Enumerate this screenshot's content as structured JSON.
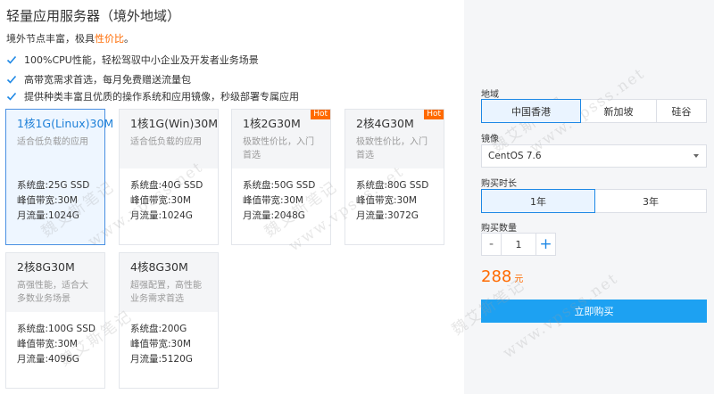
{
  "page": {
    "title": "轻量应用服务器（境外地域）",
    "subtitle_prefix": "境外节点丰富，极具",
    "subtitle_highlight": "性价比",
    "subtitle_suffix": "。"
  },
  "features": [
    "100%CPU性能，轻松驾驭中小企业及开发者业务场景",
    "高带宽需求首选，每月免费赠送流量包",
    "提供种类丰富且优质的操作系统和应用镜像，秒级部署专属应用"
  ],
  "plans": [
    {
      "name": "1核1G(Linux)30M",
      "desc": "适合低负载的应用",
      "disk": "系统盘:25G SSD",
      "bandwidth": "峰值带宽:30M",
      "traffic": "月流量:1024G",
      "hot": ""
    },
    {
      "name": "1核1G(Win)30M",
      "desc": "适合低负载的应用",
      "disk": "系统盘:40G SSD",
      "bandwidth": "峰值带宽:30M",
      "traffic": "月流量:1024G",
      "hot": ""
    },
    {
      "name": "1核2G30M",
      "desc": "极致性价比，入门首选",
      "disk": "系统盘:50G SSD",
      "bandwidth": "峰值带宽:30M",
      "traffic": "月流量:2048G",
      "hot": "Hot"
    },
    {
      "name": "2核4G30M",
      "desc": "极致性价比，入门首选",
      "disk": "系统盘:80G SSD",
      "bandwidth": "峰值带宽:30M",
      "traffic": "月流量:3072G",
      "hot": "Hot"
    },
    {
      "name": "2核8G30M",
      "desc": "高强性能，适合大多数业务场景",
      "disk": "系统盘:100G SSD",
      "bandwidth": "峰值带宽:30M",
      "traffic": "月流量:4096G",
      "hot": ""
    },
    {
      "name": "4核8G30M",
      "desc": "超强配置，高性能业务需求首选",
      "disk": "系统盘:200G",
      "bandwidth": "峰值带宽:30M",
      "traffic": "月流量:5120G",
      "hot": ""
    }
  ],
  "selected_plan": "1核1G(Linux)30M",
  "order": {
    "region_label": "地域",
    "regions": [
      "中国香港",
      "新加坡",
      "硅谷"
    ],
    "selected_region": "中国香港",
    "image_label": "镜像",
    "image_value": "CentOS 7.6",
    "duration_label": "购买时长",
    "durations": [
      "1年",
      "3年"
    ],
    "selected_duration": "1年",
    "quantity_label": "购买数量",
    "quantity": "1",
    "minus": "-",
    "plus": "+",
    "price": "288",
    "price_unit": "元",
    "buy_label": "立即购买"
  },
  "watermark": {
    "cn": "魏艾斯笔记",
    "url": "www.vpsss.net"
  },
  "colors": {
    "accent": "#1da1f2",
    "price": "#ff6a00",
    "hot_badge": "#ff6a00",
    "selected_border": "#4a90e2",
    "check": "#1e88e5"
  }
}
